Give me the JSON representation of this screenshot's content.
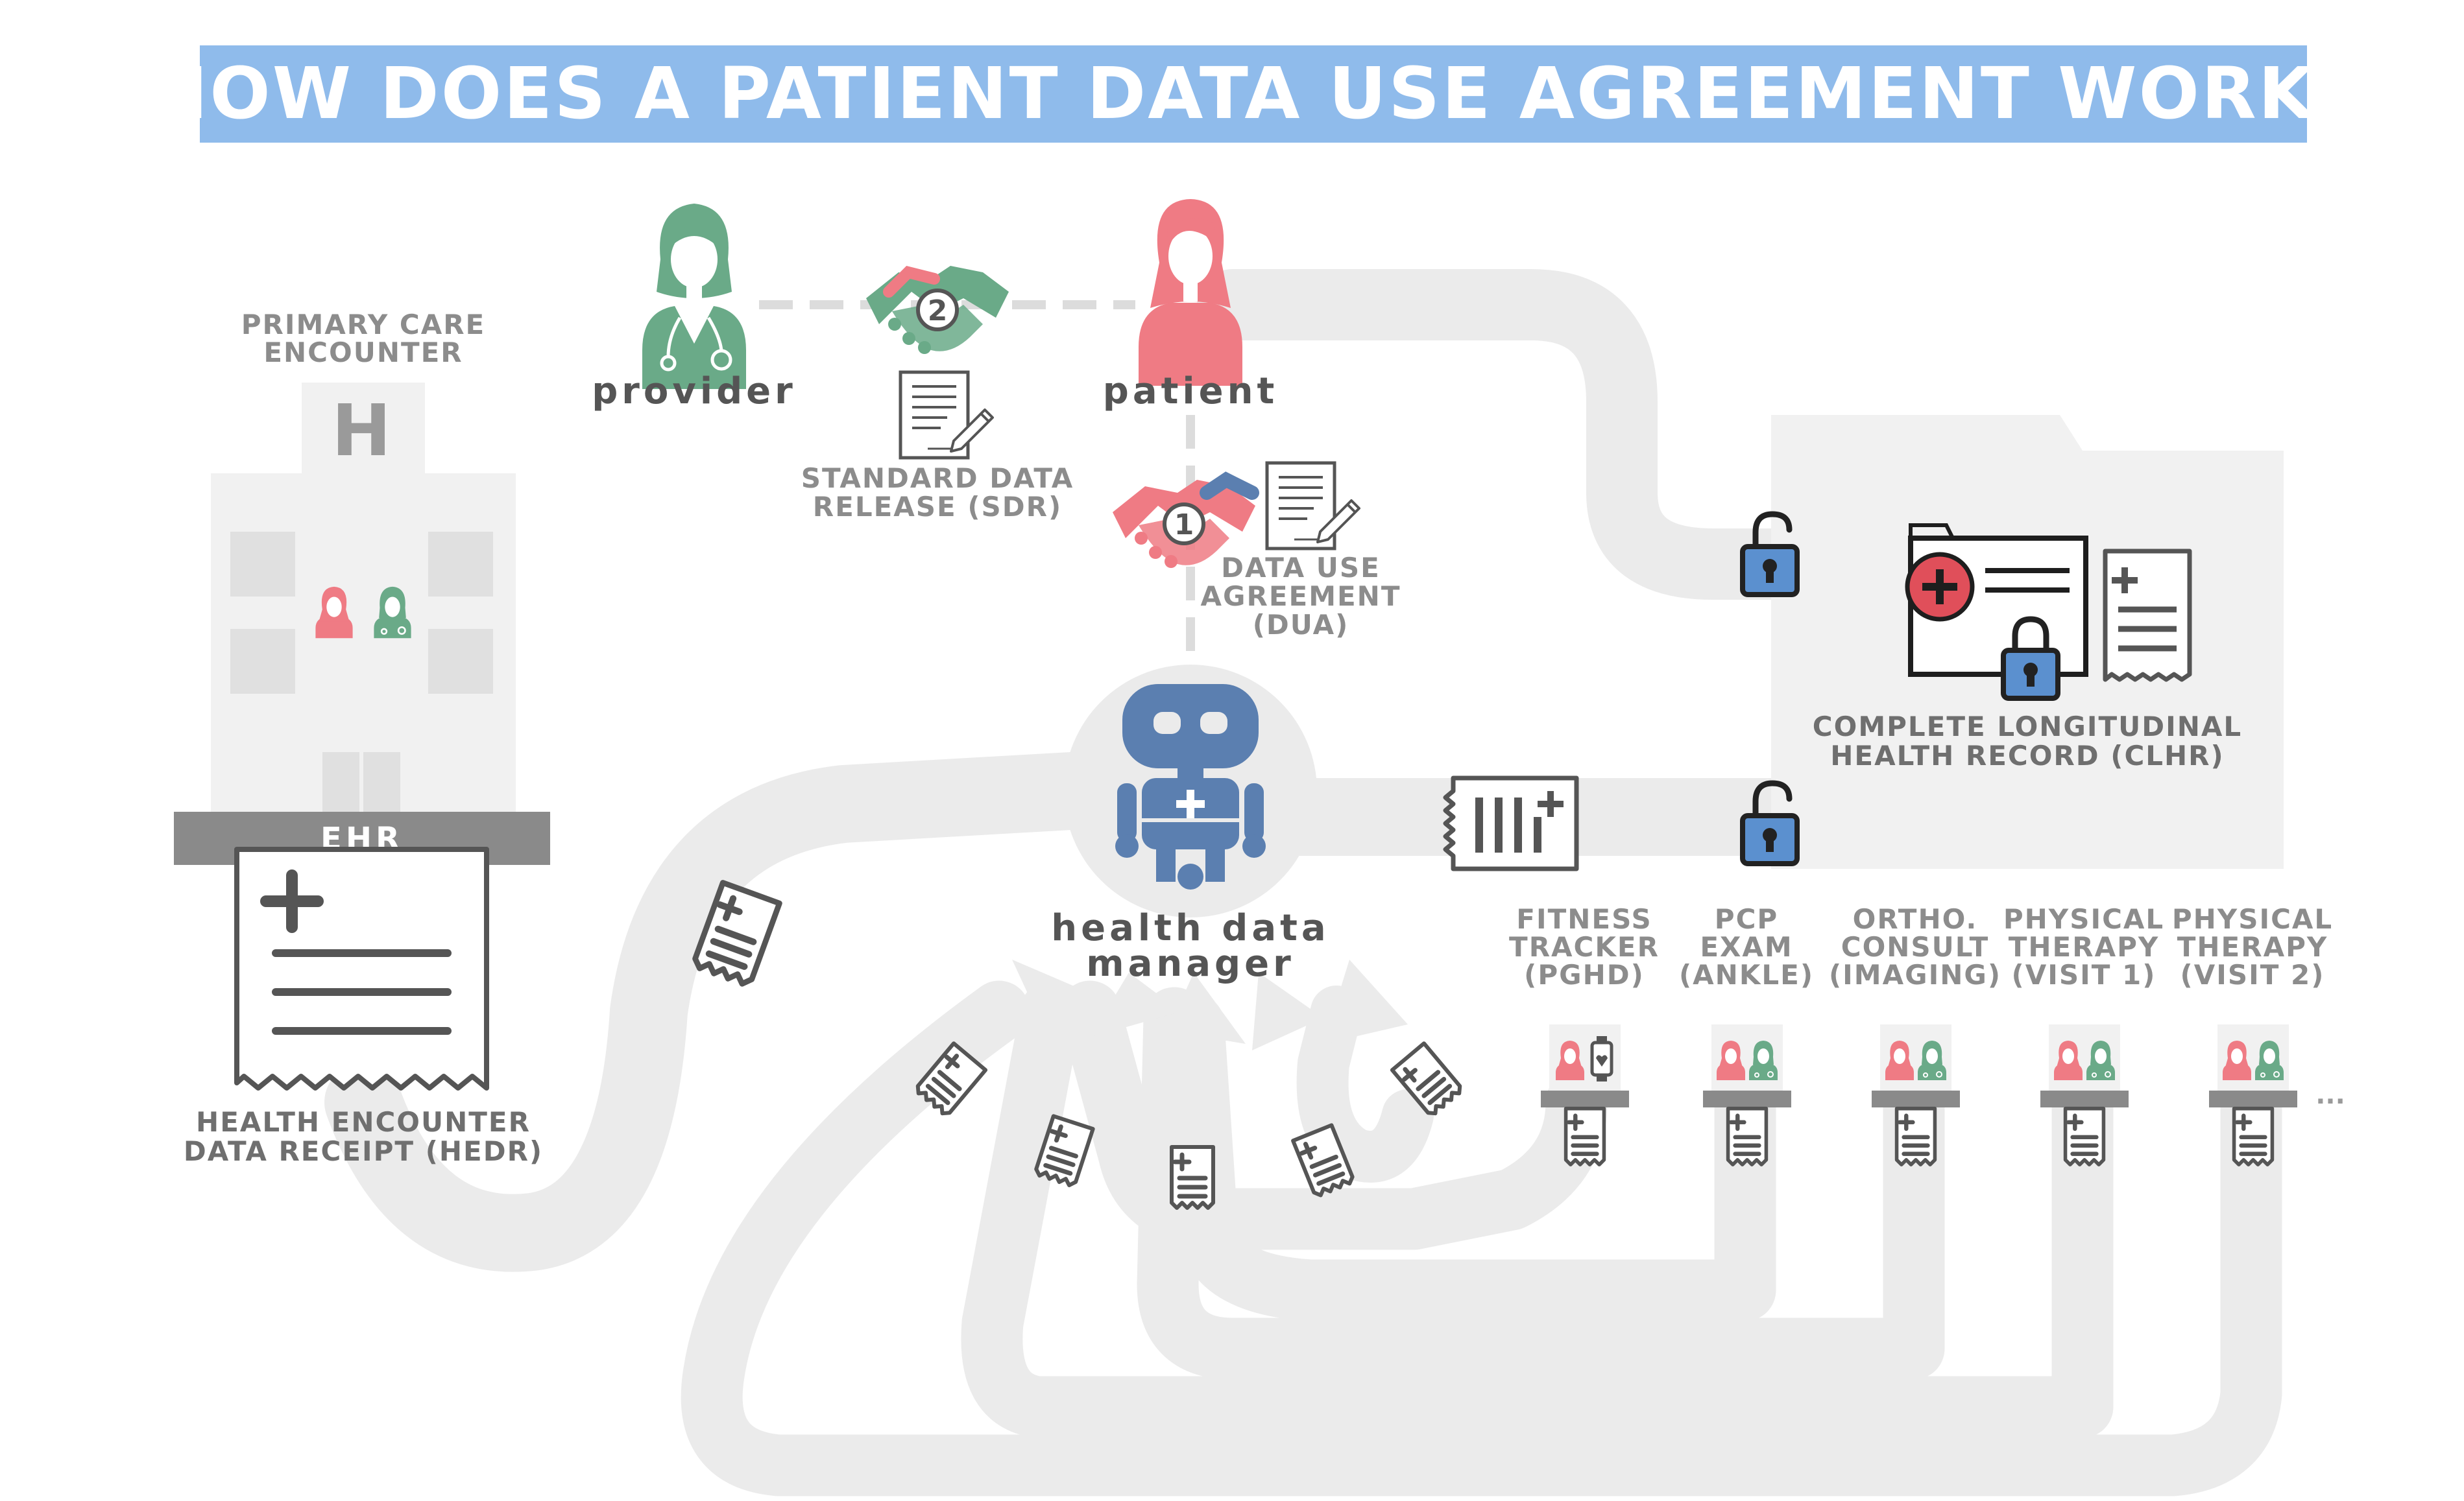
{
  "title": "HOW DOES A PATIENT DATA USE AGREEMENT WORK?",
  "primary_care": {
    "line1": "PRIMARY CARE",
    "line2": "ENCOUNTER"
  },
  "hospital_sign": "H",
  "ehr": "EHR",
  "hedr": {
    "line1": "HEALTH ENCOUNTER",
    "line2": "DATA RECEIPT (HEDR)"
  },
  "provider": "provider",
  "patient": "patient",
  "step_release": "2",
  "step_agreement": "1",
  "sdr": {
    "line1": "STANDARD DATA",
    "line2": "RELEASE (SDR)"
  },
  "dua": {
    "line1": "DATA USE",
    "line2": "AGREEMENT",
    "line3": "(DUA)"
  },
  "manager": {
    "line1": "health data",
    "line2": "manager"
  },
  "clhr": {
    "line1": "COMPLETE LONGITUDINAL",
    "line2": "HEALTH RECORD (CLHR)"
  },
  "sources": [
    {
      "line1": "FITNESS",
      "line2": "TRACKER",
      "line3": "(PGHD)"
    },
    {
      "line1": "PCP",
      "line2": "EXAM",
      "line3": "(ANKLE)"
    },
    {
      "line1": "ORTHO.",
      "line2": "CONSULT",
      "line3": "(IMAGING)"
    },
    {
      "line1": "PHYSICAL",
      "line2": "THERAPY",
      "line3": "(VISIT 1)"
    },
    {
      "line1": "PHYSICAL",
      "line2": "THERAPY",
      "line3": "(VISIT 2)"
    }
  ],
  "ellipsis": "...",
  "colors": {
    "banner": "#8fbbeb",
    "provider": "#6aaa88",
    "patient": "#ef7b84",
    "robot": "#5b7fb0",
    "lock": "#5b90cf",
    "path": "#ebebeb",
    "building": "#f1f1f1",
    "ehr_bar": "#8a8a8a",
    "document": "#555555"
  }
}
